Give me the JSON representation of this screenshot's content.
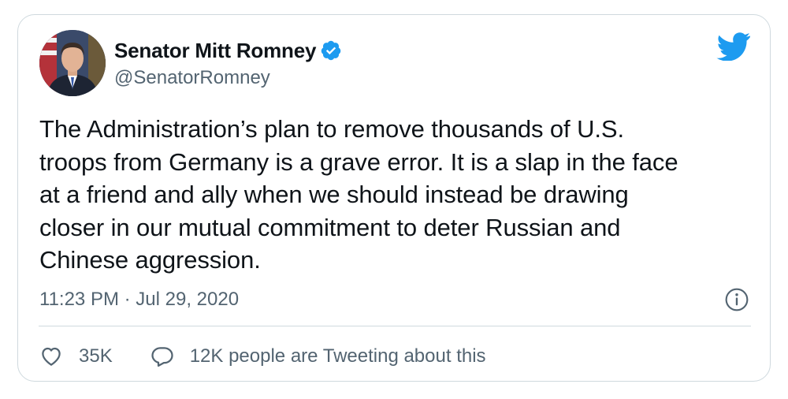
{
  "author": {
    "display_name": "Senator Mitt Romney",
    "handle": "@SenatorRomney",
    "verified": true,
    "avatar_icon": "profile-photo"
  },
  "tweet": {
    "text_lines": [
      "The Administration’s plan to remove thousands of U.S.",
      "troops from Germany is a grave error. It is a slap in the face",
      "at a friend and ally when we should instead be drawing",
      "closer in our mutual commitment to deter Russian and",
      "Chinese aggression."
    ],
    "timestamp": "11:23 PM · Jul 29, 2020"
  },
  "actions": {
    "like_count": "35K",
    "reply_text": "12K people are Tweeting about this"
  },
  "icons": {
    "brand": "twitter-bird-icon",
    "verified": "verified-badge-icon",
    "info": "info-icon",
    "like": "heart-icon",
    "reply": "speech-bubble-icon"
  },
  "colors": {
    "brand_blue": "#1d9bf0",
    "text_primary": "#0f1419",
    "text_secondary": "#536471",
    "border": "#cfd9de"
  }
}
